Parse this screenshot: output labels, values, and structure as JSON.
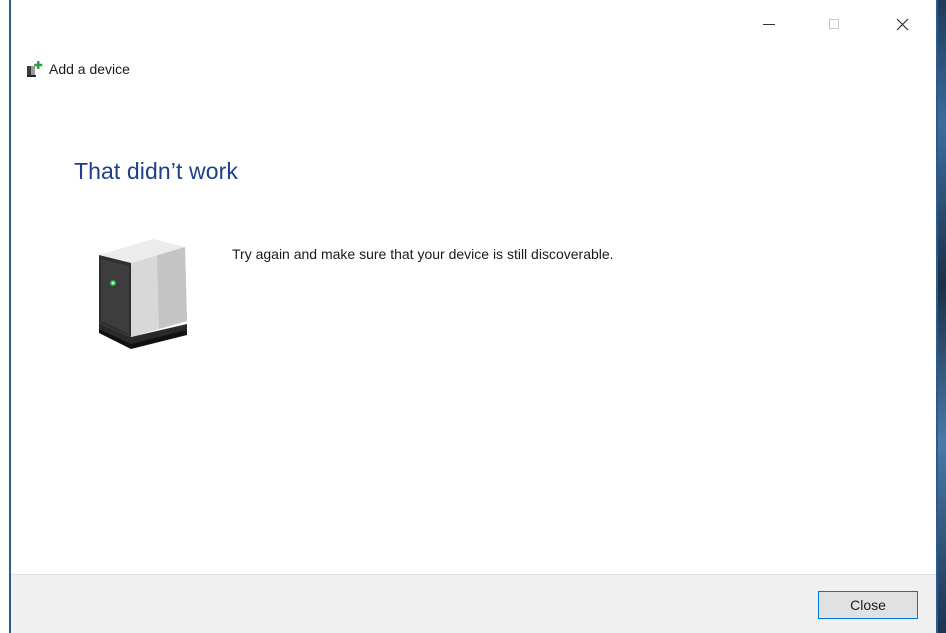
{
  "window": {
    "title": "Add a device",
    "controls": {
      "minimize": "minimize",
      "maximize": "maximize",
      "close": "close"
    }
  },
  "content": {
    "heading": "That didn’t work",
    "message": "Try again and make sure that your device is still discoverable.",
    "illustration_icon": "device-tower-icon"
  },
  "footer": {
    "close_label": "Close"
  },
  "colors": {
    "heading": "#1e3f8c",
    "footer_bg": "#f0f0f0",
    "button_border": "#0078d7",
    "button_bg": "#e1e1e1"
  }
}
